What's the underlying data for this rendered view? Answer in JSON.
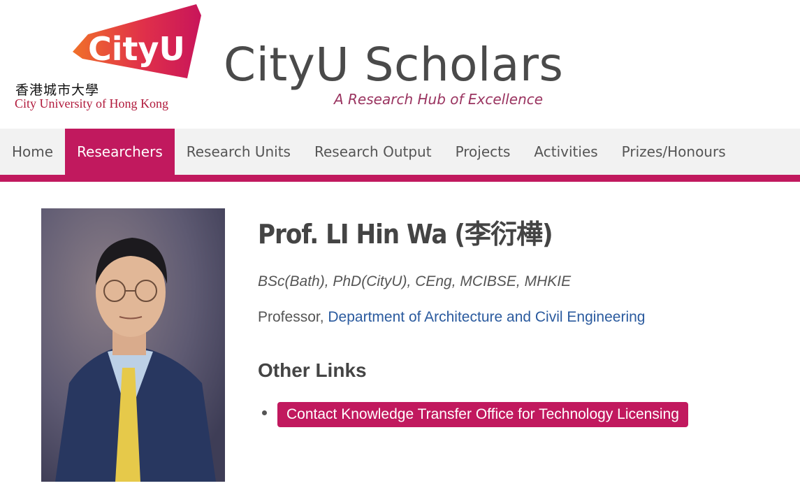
{
  "brand": {
    "logo_word": "CityU",
    "logo_cn": "香港城市大學",
    "logo_en": "City University of Hong Kong",
    "site_title": "CityU Scholars",
    "site_subtitle": "A Research Hub of Excellence",
    "accent_color": "#c1195e"
  },
  "nav": {
    "items": [
      {
        "label": "Home",
        "active": false
      },
      {
        "label": "Researchers",
        "active": true
      },
      {
        "label": "Research Units",
        "active": false
      },
      {
        "label": "Research Output",
        "active": false
      },
      {
        "label": "Projects",
        "active": false
      },
      {
        "label": "Activities",
        "active": false
      },
      {
        "label": "Prizes/Honours",
        "active": false
      }
    ]
  },
  "profile": {
    "name": "Prof. LI Hin Wa (李衍樺)",
    "qualifications": "BSc(Bath), PhD(CityU), CEng, MCIBSE, MHKIE",
    "position": "Professor, ",
    "department": "Department of Architecture and Civil Engineering",
    "other_links_heading": "Other Links",
    "links": [
      {
        "label": "Contact Knowledge Transfer Office for Technology Licensing"
      }
    ]
  }
}
